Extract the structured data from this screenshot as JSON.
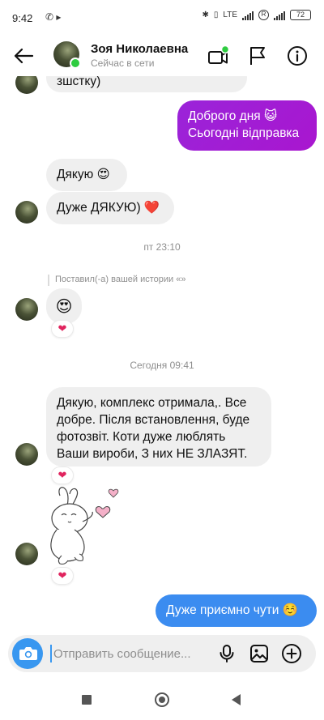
{
  "status_bar": {
    "time": "9:42",
    "lte_label": "LTE",
    "battery": "72"
  },
  "header": {
    "name": "Зоя Николаевна",
    "status": "Сейчас в сети"
  },
  "messages": {
    "partial_text": "зшстку)",
    "outgoing_1": {
      "line1": "Доброго дня 😺",
      "line2": "Сьогодні відправка"
    },
    "incoming_1": "Дякую 😍",
    "incoming_2": "Дуже ДЯКУЮ) ❤️",
    "timestamp_1": "пт 23:10",
    "story_reply_note": "Поставил(-а) вашей истории «»",
    "story_emoji": "😍",
    "timestamp_2": "Сегодня 09:41",
    "incoming_3": {
      "line1": "Дякую, комплекс отримала,. Все",
      "line2": "добре. Після встановлення, буде",
      "line3": "фотозвіт. Коти дуже люблять",
      "line4": "Ваши вироби, З них НЕ ЗЛАЗЯТ."
    },
    "outgoing_2": "Дуже приємно чути ☺️",
    "reaction": "❤"
  },
  "composer": {
    "placeholder": "Отправить сообщение..."
  },
  "colors": {
    "accent": "#3897f0",
    "outgoing_purple": "#a21cd6",
    "incoming_gray": "#efefef",
    "online": "#2ecc40"
  },
  "icons": [
    "back-arrow-icon",
    "video-call-icon",
    "flag-icon",
    "info-icon",
    "camera-icon",
    "mic-icon",
    "gallery-icon",
    "plus-icon",
    "heart-icon"
  ]
}
